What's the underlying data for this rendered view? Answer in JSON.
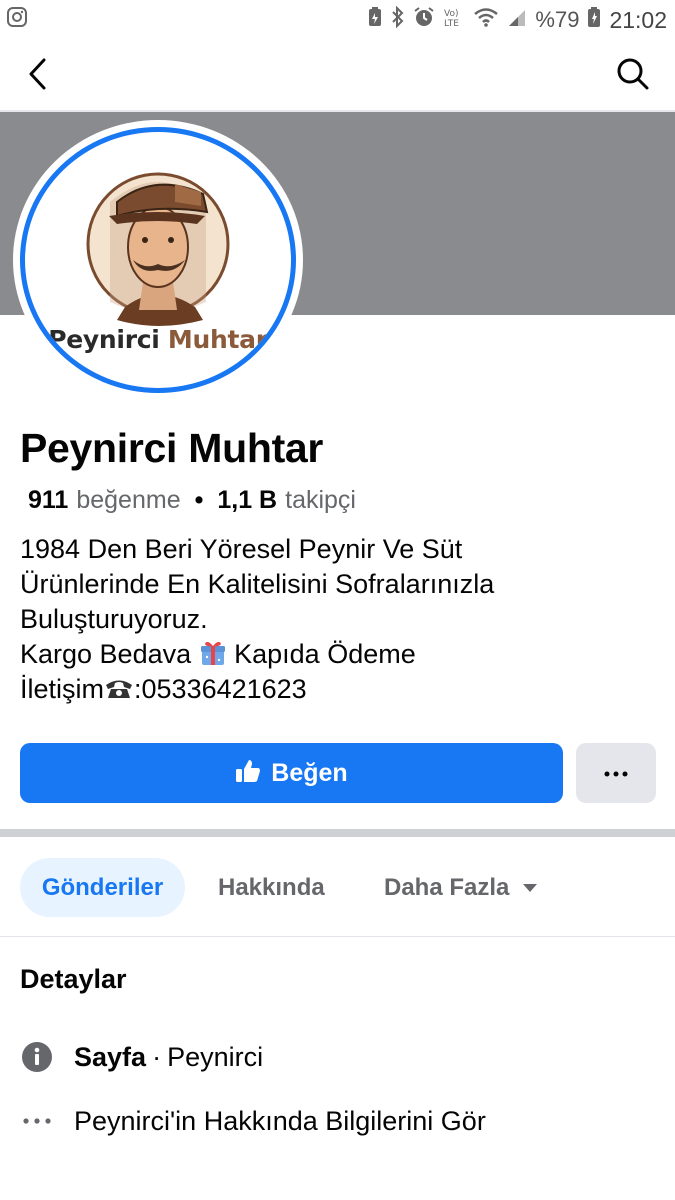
{
  "status_bar": {
    "battery": "%79",
    "time": "21:02"
  },
  "icons": {
    "app": "instagram-icon",
    "back": "back-arrow-icon",
    "search": "search-icon",
    "like": "thumbs-up-icon",
    "more": "more-dots-icon",
    "info": "info-icon",
    "ellipsis": "ellipsis-icon",
    "gift": "gift-icon",
    "phone": "phone-icon"
  },
  "profile": {
    "logo_word1": "Peynirci",
    "logo_word2": "Muhtar",
    "name": "Peynirci Muhtar",
    "likes_count": "911",
    "likes_label": "beğenme",
    "followers_count": "1,1 B",
    "followers_label": "takipçi",
    "bio": {
      "line1": "1984 Den Beri Yöresel Peynir Ve Süt",
      "line2": "Ürünlerinde En Kalitelisini Sofralarınızla",
      "line3": "Buluşturuyoruz.",
      "line4_a": "Kargo Bedava ",
      "line4_b": " Kapıda Ödeme",
      "line5_a": "İletişim",
      "line5_b": ":05336421623"
    }
  },
  "actions": {
    "like_label": "Beğen",
    "more_label": "···"
  },
  "tabs": [
    {
      "label": "Gönderiler"
    },
    {
      "label": "Hakkında"
    },
    {
      "label": "Daha Fazla"
    }
  ],
  "details": {
    "title": "Detaylar",
    "type_label": "Sayfa",
    "type_value": "Peynirci",
    "see_about": "Peynirci'in Hakkında Bilgilerini Gör"
  },
  "colors": {
    "accent": "#1877f2",
    "cover": "#898b8e",
    "tab_active_bg": "#e7f3ff"
  }
}
